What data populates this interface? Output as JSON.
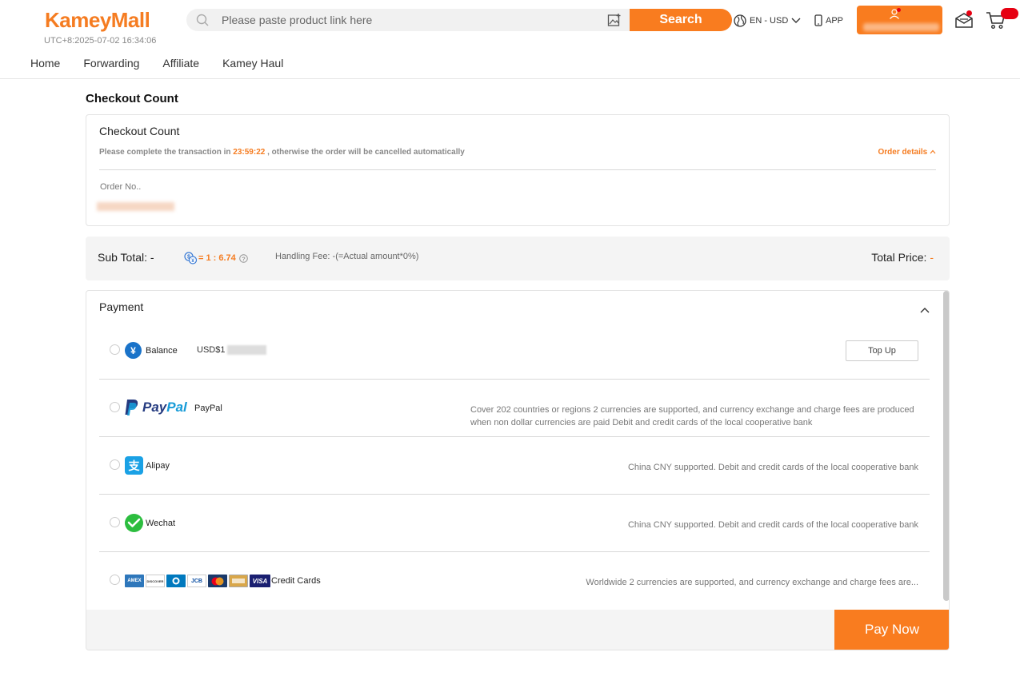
{
  "header": {
    "logo": "KameyMall",
    "datetime": "UTC+8:2025-07-02 16:34:06",
    "search_placeholder": "Please paste product link here",
    "search_button": "Search",
    "language": "EN - USD",
    "app_label": "APP"
  },
  "nav": {
    "items": [
      "Home",
      "Forwarding",
      "Affiliate",
      "Kamey Haul"
    ]
  },
  "page_title": "Checkout Count",
  "order": {
    "title": "Checkout Count",
    "notice_prefix": "Please complete the transaction in ",
    "countdown": "23:59:22",
    "notice_suffix": " , otherwise the order will be cancelled automatically",
    "details_link": "Order details",
    "order_no_label": "Order No.."
  },
  "totals": {
    "subtotal_label": "Sub Total: -",
    "rate": "= 1 : 6.74",
    "handling_fee": "Handling Fee: -(=Actual amount*0%)",
    "total_label": "Total Price: ",
    "total_value": "-"
  },
  "payment": {
    "title": "Payment",
    "methods": [
      {
        "name": "Balance",
        "amount": "USD$1",
        "action": "Top Up",
        "icon": "yen-icon"
      },
      {
        "name": "PayPal",
        "brand": "PayPal",
        "desc": "Cover 202 countries or regions 2 currencies are supported, and currency exchange and charge fees are produced when non dollar currencies are paid Debit and credit cards of the local cooperative bank",
        "icon": "paypal-icon"
      },
      {
        "name": "Alipay",
        "desc": "China CNY supported. Debit and credit cards of the local cooperative bank",
        "icon": "alipay-icon"
      },
      {
        "name": "Wechat",
        "desc": "China CNY supported. Debit and credit cards of the local cooperative bank",
        "icon": "wechat-icon"
      },
      {
        "name": "Credit Cards",
        "desc": "Worldwide 2 currencies are supported, and currency exchange and charge fees are...",
        "icon": "credit-cards-icon",
        "card_labels": [
          "AMEX",
          "DISCOVER",
          "",
          "JCB",
          "",
          "",
          "VISA"
        ]
      }
    ],
    "pay_button": "Pay Now"
  },
  "colors": {
    "accent": "#f97c1f",
    "alert": "#e60012"
  }
}
